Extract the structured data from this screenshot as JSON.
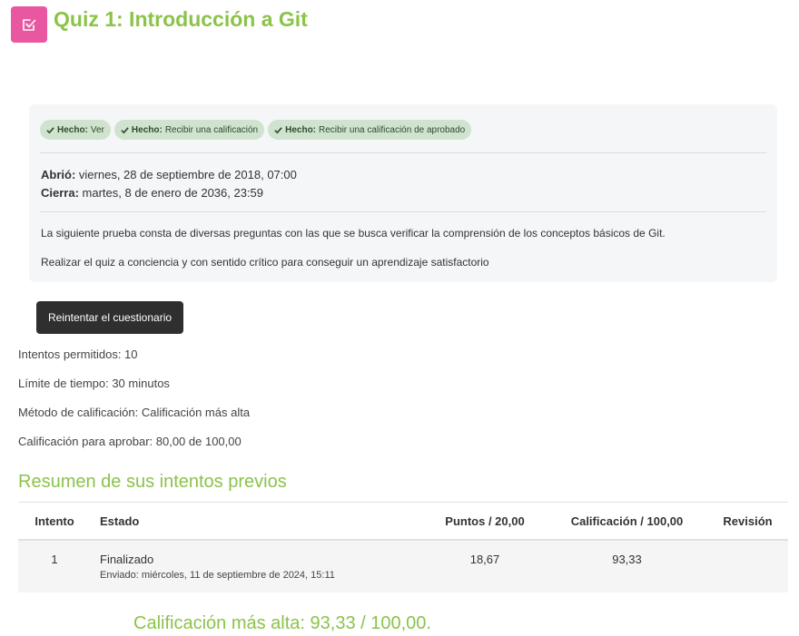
{
  "header": {
    "title": "Quiz 1: Introducción a Git",
    "icon": "quiz-check-icon"
  },
  "completion": [
    {
      "label": "Hecho:",
      "text": "Ver"
    },
    {
      "label": "Hecho:",
      "text": "Recibir una calificación"
    },
    {
      "label": "Hecho:",
      "text": "Recibir una calificación de aprobado"
    }
  ],
  "dates": {
    "opened_label": "Abrió:",
    "opened_value": "viernes, 28 de septiembre de 2018, 07:00",
    "closes_label": "Cierra:",
    "closes_value": "martes, 8 de enero de 2036, 23:59"
  },
  "description": [
    "La siguiente prueba consta de diversas preguntas con las que se busca verificar la comprensión de los conceptos básicos de Git.",
    "Realizar el quiz a conciencia y con sentido crítico para conseguir un aprendizaje satisfactorio"
  ],
  "retry_button": "Reintentar el cuestionario",
  "quiz_info": [
    "Intentos permitidos: 10",
    "Límite de tiempo: 30 minutos",
    "Método de calificación: Calificación más alta",
    "Calificación para aprobar: 80,00 de 100,00"
  ],
  "summary_title": "Resumen de sus intentos previos",
  "table": {
    "headers": [
      "Intento",
      "Estado",
      "Puntos / 20,00",
      "Calificación / 100,00",
      "Revisión"
    ],
    "rows": [
      {
        "attempt": "1",
        "state": "Finalizado",
        "submitted": "Enviado: miércoles, 11 de septiembre de 2024, 15:11",
        "points": "18,67",
        "grade": "93,33",
        "review": ""
      }
    ]
  },
  "highest_grade": "Calificación más alta: 93,33 / 100,00.",
  "colors": {
    "accent": "#8bc34a",
    "icon_bg": "#e8579f",
    "badge_bg": "#cfe3cf",
    "button_bg": "#2f2f2f"
  }
}
